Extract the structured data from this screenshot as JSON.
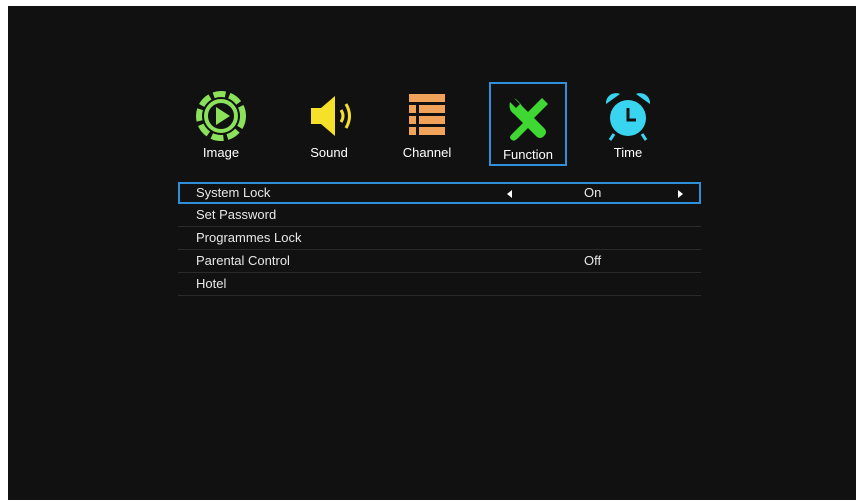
{
  "tabs": [
    {
      "label": "Image",
      "icon": "play-icon",
      "color": "#8be25a"
    },
    {
      "label": "Sound",
      "icon": "speaker-icon",
      "color": "#f5e12a"
    },
    {
      "label": "Channel",
      "icon": "list-icon",
      "color": "#f2a35a"
    },
    {
      "label": "Function",
      "icon": "tools-icon",
      "color": "#3fd832",
      "active": true
    },
    {
      "label": "Time",
      "icon": "alarm-clock-icon",
      "color": "#39d5f0"
    }
  ],
  "menu": [
    {
      "name": "System Lock",
      "value": "On",
      "selected": true
    },
    {
      "name": "Set Password",
      "value": ""
    },
    {
      "name": "Programmes Lock",
      "value": ""
    },
    {
      "name": "Parental Control",
      "value": "Off"
    },
    {
      "name": "Hotel",
      "value": ""
    }
  ],
  "colors": {
    "accent": "#2f8fd8",
    "background": "#111111"
  }
}
